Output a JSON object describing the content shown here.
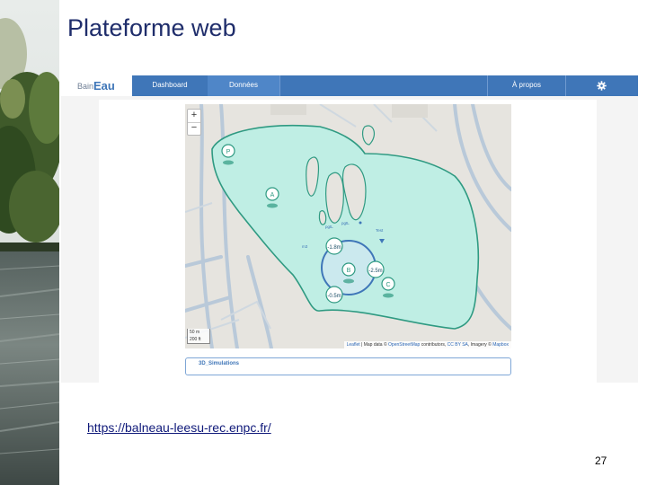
{
  "slide": {
    "title": "Plateforme web",
    "url": "https://balneau-leesu-rec.enpc.fr/",
    "page_number": "27"
  },
  "app": {
    "brand_prefix": "Bain",
    "brand_main": "Eau",
    "nav": {
      "dashboard": "Dashboard",
      "donnees": "Données",
      "apropos": "À propos"
    },
    "settings_icon": "gear-icon",
    "accent_color": "#3f76b8"
  },
  "map": {
    "zoom_in": "+",
    "zoom_out": "−",
    "scale_m": "50 m",
    "scale_ft": "200 ft",
    "attribution_leaflet": "Leaflet",
    "attribution_text": " | Map data © ",
    "attribution_osm": "OpenStreetMap",
    "attribution_rest": " contributors, ",
    "attribution_license": "CC BY SA",
    "attribution_imagery": ", Imagery © ",
    "attribution_mapbox": "Mapbox",
    "water_color": "#bfeee4",
    "outline_color": "#2f9a82",
    "markers": {
      "p": "P",
      "a": "A",
      "b": "B",
      "c": "C"
    },
    "depths": {
      "d1": "-1.8m",
      "d2": "-2.5m",
      "d3": "-0.5m"
    },
    "small_labels": {
      "l1": "pgtL",
      "l2": "pgtL",
      "l3": "Test",
      "l4": "m3"
    }
  },
  "simulations_label": "3D_Simulations"
}
